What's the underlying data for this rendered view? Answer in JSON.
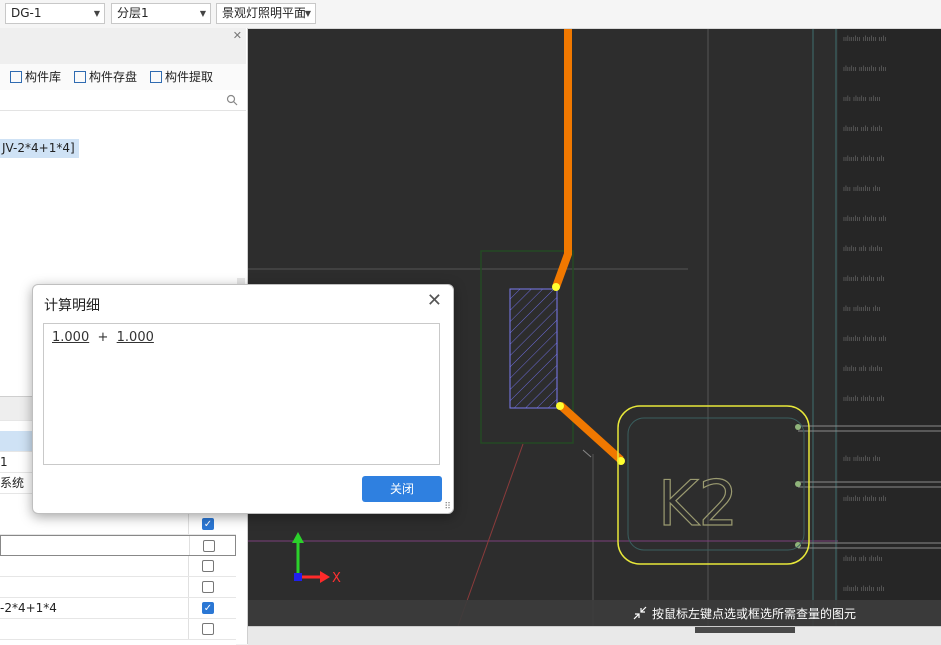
{
  "topbar": {
    "combo1": "DG-1",
    "combo2": "分层1",
    "combo3": "景观灯照明平面"
  },
  "left_panel": {
    "toolbar": {
      "library": "构件库",
      "save": "构件存盘",
      "extract": "构件提取"
    },
    "tree_selected": "JV-2*4+1*4]",
    "rows": [
      {
        "text": "1",
        "checked": null
      },
      {
        "text": "系统",
        "checked": null
      },
      {
        "text": "",
        "checked": true
      },
      {
        "text": "",
        "checked": false
      },
      {
        "text": "",
        "checked": false
      },
      {
        "text": "",
        "checked": false
      },
      {
        "text": "-2*4+1*4",
        "checked": true
      },
      {
        "text": "",
        "checked": false
      }
    ]
  },
  "canvas": {
    "label": "K2",
    "axis_x": "X",
    "status": "按鼠标左键点选或框选所需查量的图元"
  },
  "dialog": {
    "title": "计算明细",
    "value1": "1.000",
    "op": "+",
    "value2": "1.000",
    "close_label": "关闭"
  },
  "colors": {
    "pipe": "#f07800",
    "highlight_box": "#e8e83a",
    "button": "#2f80e0"
  }
}
